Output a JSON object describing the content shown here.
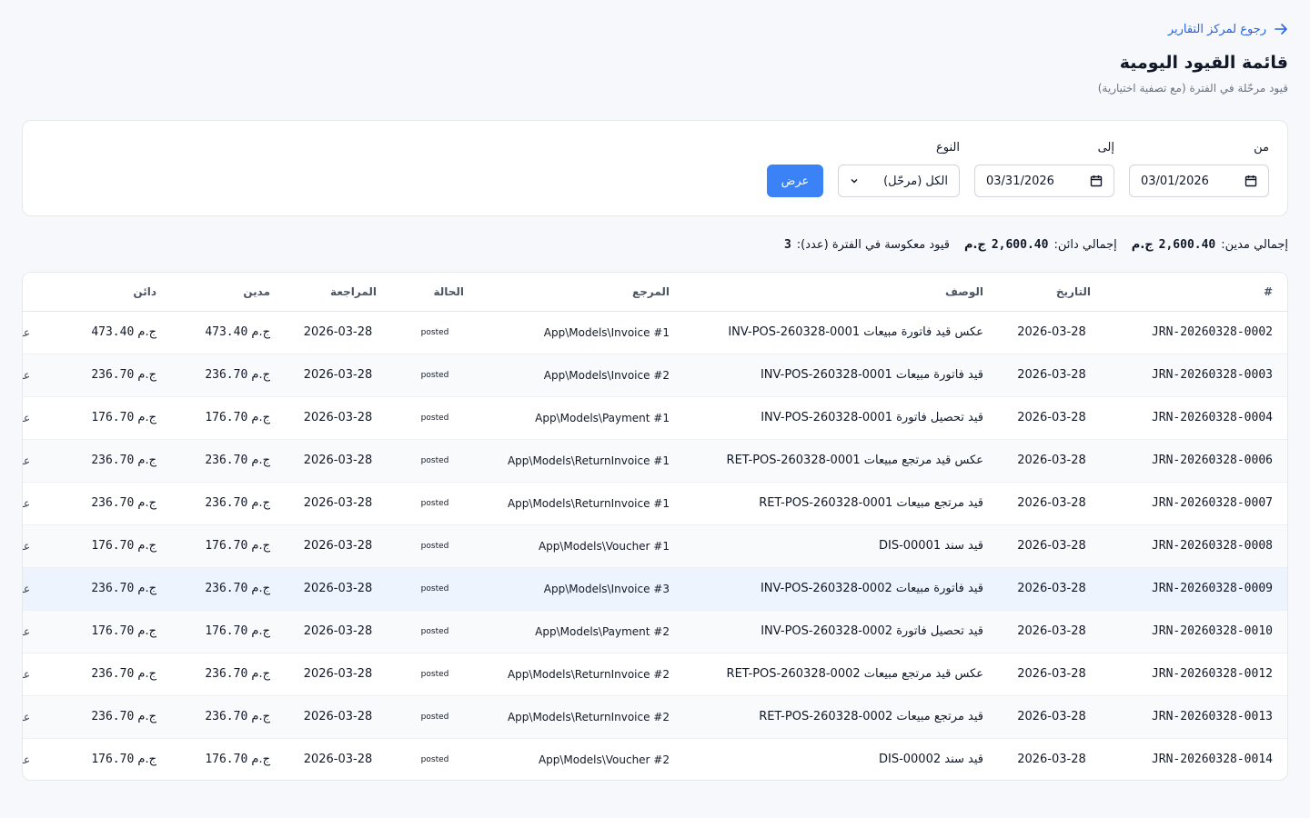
{
  "header": {
    "back_label": "رجوع لمركز التقارير",
    "title": "قائمة القيود اليومية",
    "subtitle": "قيود مرحّلة في الفترة (مع تصفية اختيارية)"
  },
  "filters": {
    "from_label": "من",
    "from_value": "03/01/2026",
    "to_label": "إلى",
    "to_value": "03/31/2026",
    "type_label": "النوع",
    "type_value": "الكل (مرحّل)",
    "submit_label": "عرض"
  },
  "totals": {
    "debit_label": "إجمالي مدين:",
    "debit_value": "2,600.40",
    "debit_currency": "ج.م",
    "credit_label": "إجمالي دائن:",
    "credit_value": "2,600.40",
    "credit_currency": "ج.م",
    "reversed_label": "قيود معكوسة في الفترة (عدد):",
    "reversed_value": "3"
  },
  "table": {
    "columns": [
      "#",
      "التاريخ",
      "الوصف",
      "المرجع",
      "الحالة",
      "المراجعة",
      "مدين",
      "دائن",
      ""
    ],
    "currency": "ج.م",
    "action_label": "عرض",
    "rows": [
      {
        "id": "JRN-20260328-0002",
        "date": "2026-03-28",
        "desc": "عكس قيد فاتورة مبيعات INV-POS-260328-0001",
        "ref": "App\\Models\\Invoice #1",
        "status": "posted",
        "reviewed": "2026-03-28",
        "debit": "473.40",
        "credit": "473.40"
      },
      {
        "id": "JRN-20260328-0003",
        "date": "2026-03-28",
        "desc": "قيد فاتورة مبيعات INV-POS-260328-0001",
        "ref": "App\\Models\\Invoice #2",
        "status": "posted",
        "reviewed": "2026-03-28",
        "debit": "236.70",
        "credit": "236.70"
      },
      {
        "id": "JRN-20260328-0004",
        "date": "2026-03-28",
        "desc": "قيد تحصيل فاتورة INV-POS-260328-0001",
        "ref": "App\\Models\\Payment #1",
        "status": "posted",
        "reviewed": "2026-03-28",
        "debit": "176.70",
        "credit": "176.70"
      },
      {
        "id": "JRN-20260328-0006",
        "date": "2026-03-28",
        "desc": "عكس قيد مرتجع مبيعات RET-POS-260328-0001",
        "ref": "App\\Models\\ReturnInvoice #1",
        "status": "posted",
        "reviewed": "2026-03-28",
        "debit": "236.70",
        "credit": "236.70"
      },
      {
        "id": "JRN-20260328-0007",
        "date": "2026-03-28",
        "desc": "قيد مرتجع مبيعات RET-POS-260328-0001",
        "ref": "App\\Models\\ReturnInvoice #1",
        "status": "posted",
        "reviewed": "2026-03-28",
        "debit": "236.70",
        "credit": "236.70"
      },
      {
        "id": "JRN-20260328-0008",
        "date": "2026-03-28",
        "desc": "قيد سند DIS-00001",
        "ref": "App\\Models\\Voucher #1",
        "status": "posted",
        "reviewed": "2026-03-28",
        "debit": "176.70",
        "credit": "176.70"
      },
      {
        "id": "JRN-20260328-0009",
        "date": "2026-03-28",
        "desc": "قيد فاتورة مبيعات INV-POS-260328-0002",
        "ref": "App\\Models\\Invoice #3",
        "status": "posted",
        "reviewed": "2026-03-28",
        "debit": "236.70",
        "credit": "236.70"
      },
      {
        "id": "JRN-20260328-0010",
        "date": "2026-03-28",
        "desc": "قيد تحصيل فاتورة INV-POS-260328-0002",
        "ref": "App\\Models\\Payment #2",
        "status": "posted",
        "reviewed": "2026-03-28",
        "debit": "176.70",
        "credit": "176.70"
      },
      {
        "id": "JRN-20260328-0012",
        "date": "2026-03-28",
        "desc": "عكس قيد مرتجع مبيعات RET-POS-260328-0002",
        "ref": "App\\Models\\ReturnInvoice #2",
        "status": "posted",
        "reviewed": "2026-03-28",
        "debit": "236.70",
        "credit": "236.70"
      },
      {
        "id": "JRN-20260328-0013",
        "date": "2026-03-28",
        "desc": "قيد مرتجع مبيعات RET-POS-260328-0002",
        "ref": "App\\Models\\ReturnInvoice #2",
        "status": "posted",
        "reviewed": "2026-03-28",
        "debit": "236.70",
        "credit": "236.70"
      },
      {
        "id": "JRN-20260328-0014",
        "date": "2026-03-28",
        "desc": "قيد سند DIS-00002",
        "ref": "App\\Models\\Voucher #2",
        "status": "posted",
        "reviewed": "2026-03-28",
        "debit": "176.70",
        "credit": "176.70"
      }
    ]
  },
  "colors": {
    "accent": "#3b82f6",
    "link": "#2563eb",
    "highlight_row": "#eef4fd"
  }
}
